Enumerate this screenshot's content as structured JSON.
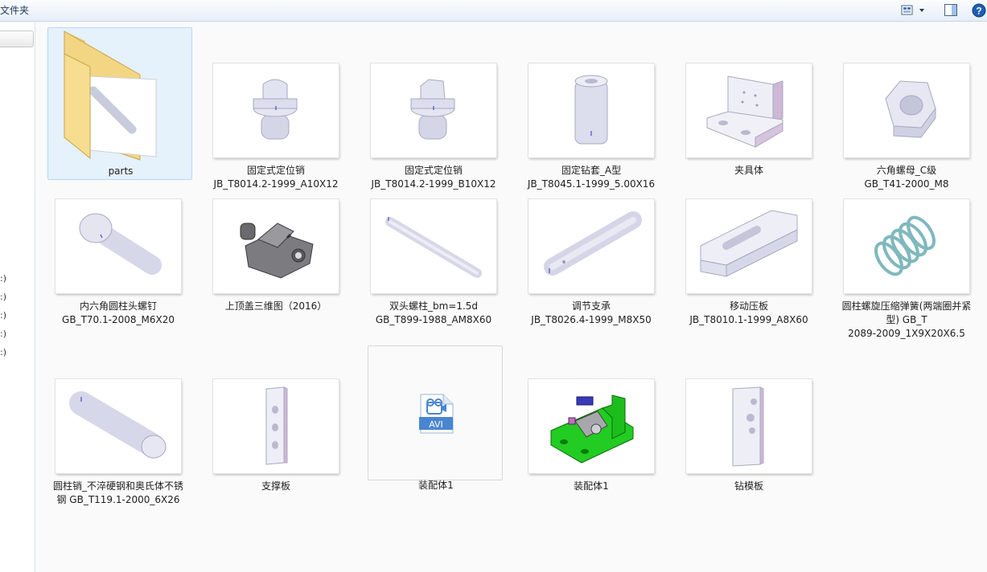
{
  "toolbar": {
    "title": "文件夹",
    "icons": {
      "view": "change-view-icon",
      "preview": "preview-pane-icon",
      "help": "help-icon"
    }
  },
  "nav": {
    "drive_labels": [
      ":)",
      ":)",
      ":)",
      ":)",
      ":)"
    ]
  },
  "colors": {
    "selection": "#e5f1fb",
    "selection_border": "#b9d7f1",
    "green_fixture": "#22cc22",
    "help_blue": "#1e5fb4"
  },
  "files": [
    {
      "name": "parts",
      "kind": "folder"
    },
    {
      "name": "固定式定位销\nJB_T8014.2-1999_A10X12",
      "kind": "pin"
    },
    {
      "name": "固定式定位销\nJB_T8014.2-1999_B10X12",
      "kind": "pin"
    },
    {
      "name": "固定钻套_A型\nJB_T8045.1-1999_5.00X16",
      "kind": "bushing"
    },
    {
      "name": "夹具体",
      "kind": "fixture-body"
    },
    {
      "name": "六角螺母_C级\nGB_T41-2000_M8",
      "kind": "hex-nut"
    },
    {
      "name": "内六角圆柱头螺钉\nGB_T70.1-2008_M6X20",
      "kind": "cap-screw"
    },
    {
      "name": "上顶盖三维图（2016）",
      "kind": "top-cover"
    },
    {
      "name": "双头螺柱_bm=1.5d\nGB_T899-1988_AM8X60",
      "kind": "stud"
    },
    {
      "name": "调节支承\nJB_T8026.4-1999_M8X50",
      "kind": "support"
    },
    {
      "name": "移动压板\nJB_T8010.1-1999_A8X60",
      "kind": "clamp-plate"
    },
    {
      "name": "圆柱螺旋压缩弹簧(两端圈并紧\n型) GB_T\n2089-2009_1X9X20X6.5",
      "kind": "spring"
    },
    {
      "name": "圆柱销_不淬硬钢和奥氏体不锈\n钢 GB_T119.1-2000_6X26",
      "kind": "cyl-pin"
    },
    {
      "name": "支撑板",
      "kind": "support-plate"
    },
    {
      "name": "装配体1",
      "kind": "avi",
      "badge": "AVI"
    },
    {
      "name": "装配体1",
      "kind": "assembly"
    },
    {
      "name": "钻模板",
      "kind": "drill-plate"
    }
  ]
}
